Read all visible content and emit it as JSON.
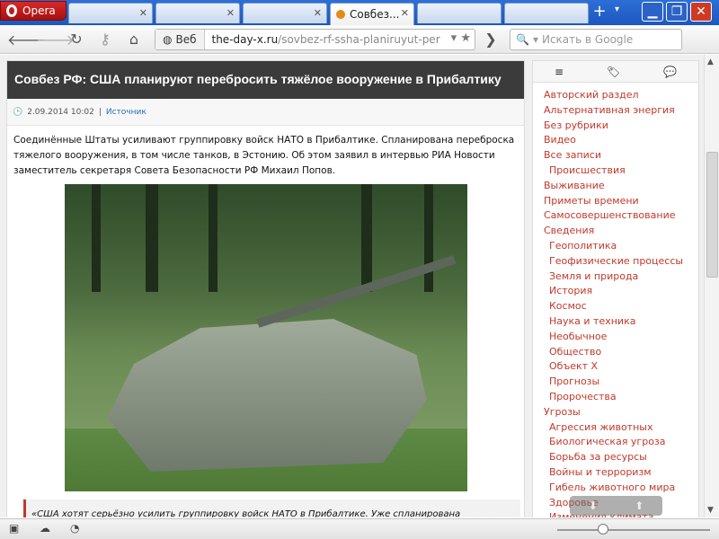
{
  "browser": {
    "menu_label": "Opera",
    "tabs": [
      {
        "label": "",
        "active": false
      },
      {
        "label": "",
        "active": false
      },
      {
        "label": "",
        "active": false
      },
      {
        "label": "Совбез...",
        "active": true
      },
      {
        "label": "",
        "active": false
      },
      {
        "label": "",
        "active": false
      }
    ],
    "new_tab": "+",
    "tab_menu": "▾",
    "address": {
      "badge": "Веб",
      "host": "the-day-x.ru",
      "path": "/sovbez-rf-ssha-planiruyut-per"
    },
    "search_placeholder": "Искать в Google"
  },
  "article": {
    "title": "Совбез РФ: США планируют перебросить тяжёлое вооружение в Прибалтику",
    "date": "2.09.2014 10:02",
    "separator": "|",
    "source_label": "Источник",
    "body": "Соединённые Штаты усиливают группировку войск НАТО в Прибалтике. Спланирована переброска тяжелого вооружения, в том числе танков, в Эстонию. Об этом заявил в интервью РИА Новости заместитель секретаря Совета Безопасности РФ Михаил Попов.",
    "quote": "«США хотят серьёзно усилить группировку войск НАТО в Прибалтике. Уже спланирована"
  },
  "sidebar": {
    "tabs": [
      "≡",
      "🏷",
      "💬"
    ],
    "items": [
      {
        "label": "Авторский раздел",
        "sub": false
      },
      {
        "label": "Альтернативная энергия",
        "sub": false
      },
      {
        "label": "Без рубрики",
        "sub": false
      },
      {
        "label": "Видео",
        "sub": false
      },
      {
        "label": "Все записи",
        "sub": false
      },
      {
        "label": "Происшествия",
        "sub": true
      },
      {
        "label": "Выживание",
        "sub": false
      },
      {
        "label": "Приметы времени",
        "sub": false
      },
      {
        "label": "Самосовершенствование",
        "sub": false
      },
      {
        "label": "Сведения",
        "sub": false
      },
      {
        "label": "Геополитика",
        "sub": true
      },
      {
        "label": "Геофизические процессы",
        "sub": true
      },
      {
        "label": "Земля и природа",
        "sub": true
      },
      {
        "label": "История",
        "sub": true
      },
      {
        "label": "Космос",
        "sub": true
      },
      {
        "label": "Наука и техника",
        "sub": true
      },
      {
        "label": "Необычное",
        "sub": true
      },
      {
        "label": "Общество",
        "sub": true
      },
      {
        "label": "Объект X",
        "sub": true
      },
      {
        "label": "Прогнозы",
        "sub": true
      },
      {
        "label": "Пророчества",
        "sub": true
      },
      {
        "label": "Угрозы",
        "sub": false
      },
      {
        "label": "Агрессия животных",
        "sub": true
      },
      {
        "label": "Биологическая угроза",
        "sub": true
      },
      {
        "label": "Борьба за ресурсы",
        "sub": true
      },
      {
        "label": "Войны и терроризм",
        "sub": true
      },
      {
        "label": "Гибель животного мира",
        "sub": true
      },
      {
        "label": "Здоровье",
        "sub": true
      },
      {
        "label": "Изменения климата",
        "sub": true
      }
    ]
  },
  "colors": {
    "accent": "#c0392b",
    "title_bar": "#3b3b3b",
    "tab_bar": "#1d57c0"
  }
}
